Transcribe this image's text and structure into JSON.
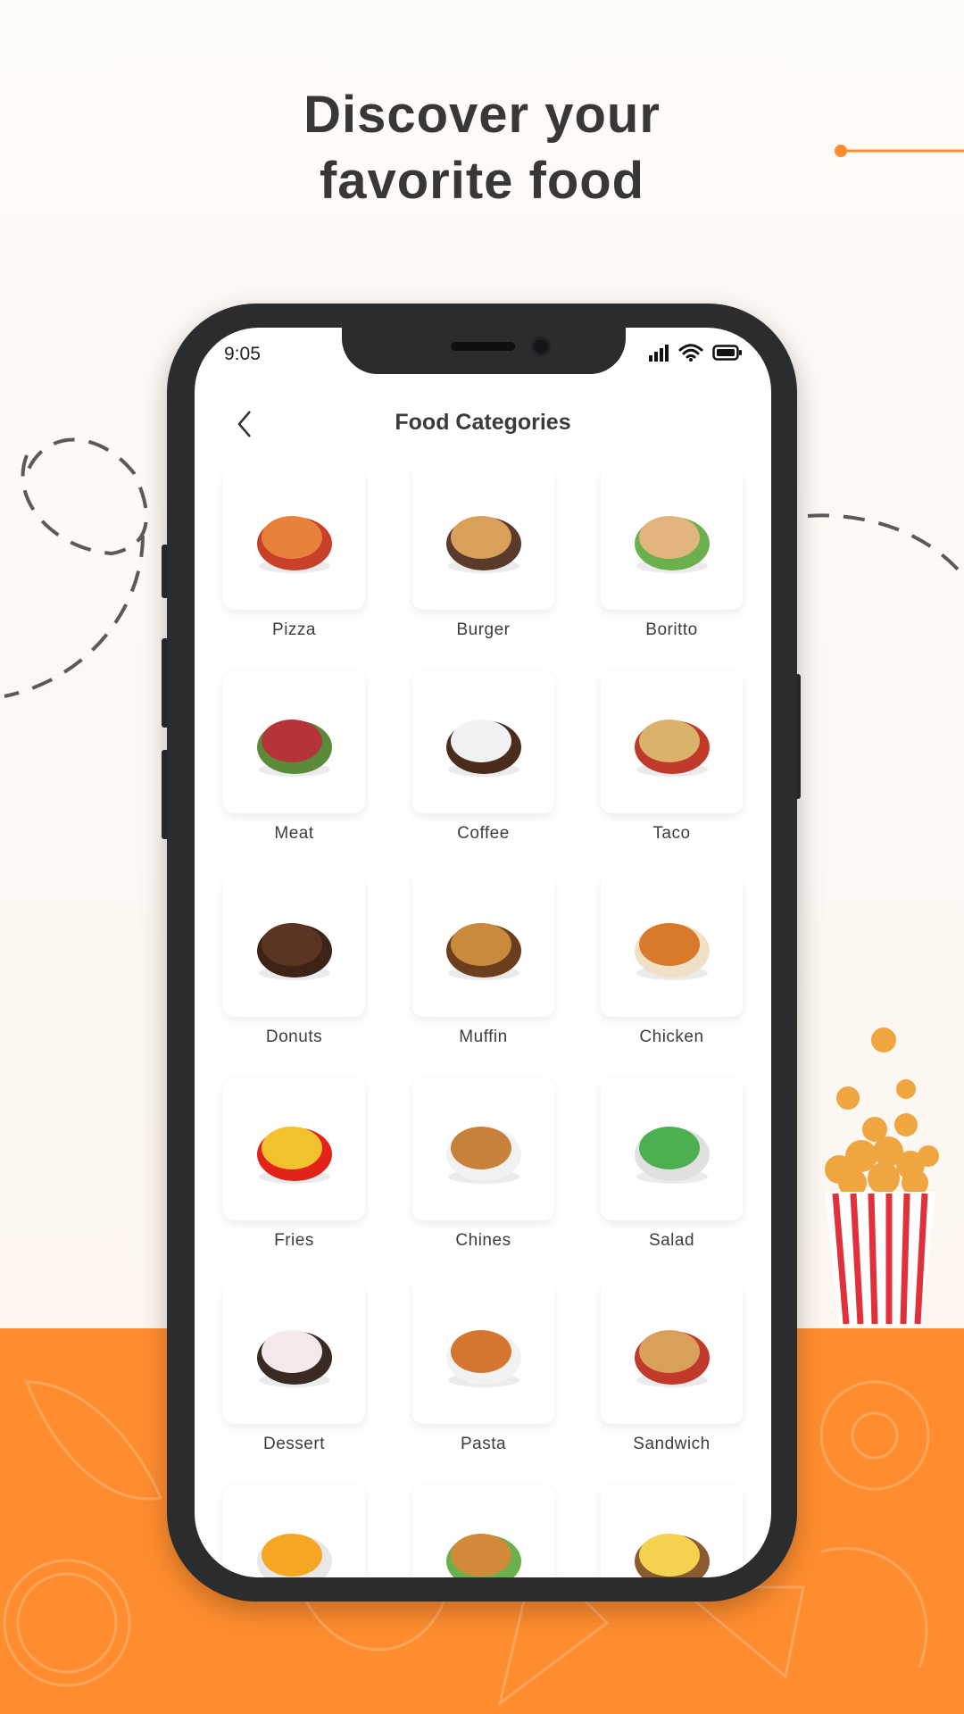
{
  "headline": {
    "line1": "Discover your",
    "line2": "favorite food"
  },
  "colors": {
    "accent": "#ff8d2f",
    "text": "#373737",
    "phone_frame": "#2b2c2e"
  },
  "status_bar": {
    "time": "9:05",
    "icons": [
      "signal-icon",
      "wifi-icon",
      "battery-icon"
    ]
  },
  "header": {
    "title": "Food Categories",
    "back_icon": "chevron-left-icon"
  },
  "categories": [
    {
      "label": "Pizza",
      "c1": "#e8823a",
      "c2": "#c8402a"
    },
    {
      "label": "Burger",
      "c1": "#d9a05b",
      "c2": "#5a3a2a"
    },
    {
      "label": "Boritto",
      "c1": "#e2b57f",
      "c2": "#6ab04c"
    },
    {
      "label": "Meat",
      "c1": "#b5343a",
      "c2": "#5b8a3a"
    },
    {
      "label": "Coffee",
      "c1": "#f2f2f2",
      "c2": "#4a2c1c"
    },
    {
      "label": "Taco",
      "c1": "#d9b36a",
      "c2": "#c0392b"
    },
    {
      "label": "Donuts",
      "c1": "#5a3522",
      "c2": "#3d2416"
    },
    {
      "label": "Muffin",
      "c1": "#c98a3e",
      "c2": "#6b3f1d"
    },
    {
      "label": "Chicken",
      "c1": "#d97a2a",
      "c2": "#f0e0c8"
    },
    {
      "label": "Fries",
      "c1": "#f2c12e",
      "c2": "#e2231a"
    },
    {
      "label": "Chines",
      "c1": "#c7813a",
      "c2": "#f2f2f2"
    },
    {
      "label": "Salad",
      "c1": "#4caf50",
      "c2": "#e0e0e0"
    },
    {
      "label": "Dessert",
      "c1": "#f5e9e9",
      "c2": "#3a2a24"
    },
    {
      "label": "Pasta",
      "c1": "#d4762f",
      "c2": "#f2f2f2"
    },
    {
      "label": "Sandwich",
      "c1": "#d9a05b",
      "c2": "#c0392b"
    },
    {
      "label": "",
      "c1": "#f5a623",
      "c2": "#e8e8e8"
    },
    {
      "label": "",
      "c1": "#d08a3a",
      "c2": "#6ab04c"
    },
    {
      "label": "",
      "c1": "#f2d24e",
      "c2": "#8a5a30"
    }
  ]
}
